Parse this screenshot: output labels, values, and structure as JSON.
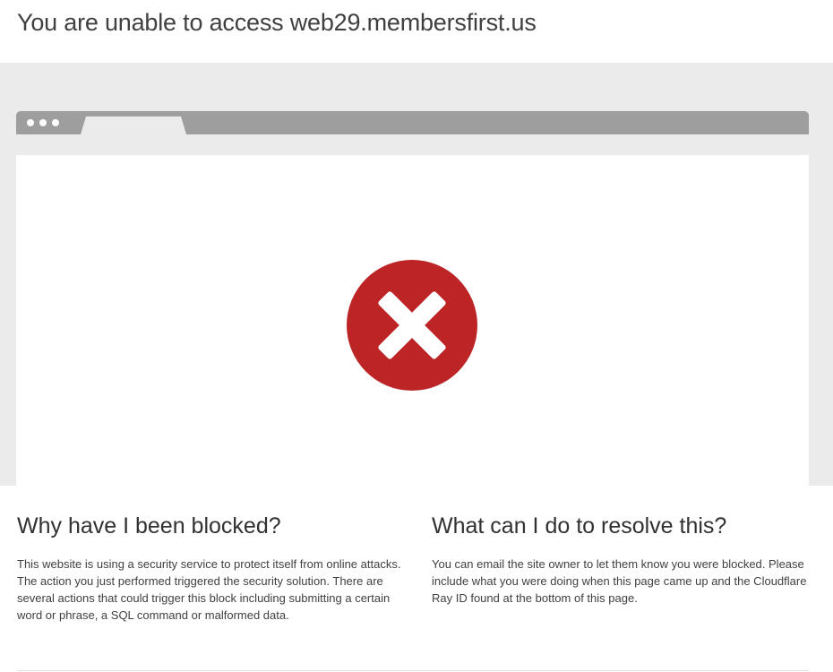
{
  "header": {
    "title": "You are unable to access web29.membersfirst.us"
  },
  "illustration": {
    "icon": "error-x-icon",
    "icon_color": "#bd2426",
    "browser_bar_color": "#9e9e9e"
  },
  "why_blocked": {
    "heading": "Why have I been blocked?",
    "body": "This website is using a security service to protect itself from online attacks. The action you just performed triggered the security solution. There are several actions that could trigger this block including submitting a certain word or phrase, a SQL command or malformed data."
  },
  "resolve": {
    "heading": "What can I do to resolve this?",
    "body": "You can email the site owner to let them know you were blocked. Please include what you were doing when this page came up and the Cloudflare Ray ID found at the bottom of this page."
  }
}
